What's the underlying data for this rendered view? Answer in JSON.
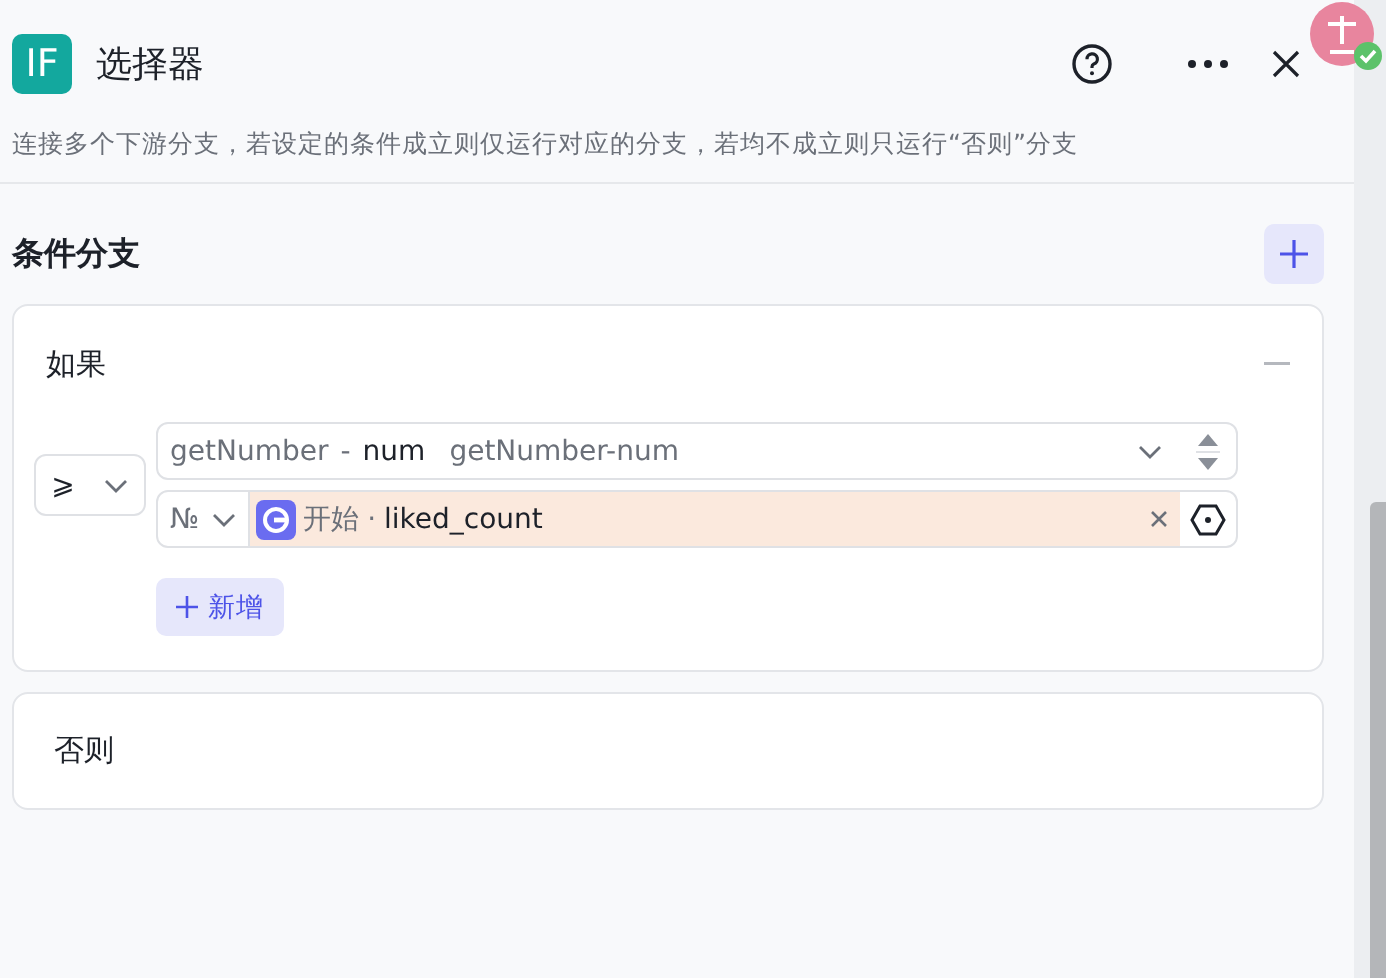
{
  "header": {
    "logo": "IF",
    "title": "选择器"
  },
  "description": "连接多个下游分支，若设定的条件成立则仅运行对应的分支，若均不成立则只运行“否则”分支",
  "section": {
    "title": "条件分支"
  },
  "branches": [
    {
      "kind": "if",
      "title": "如果",
      "operator": "⩾",
      "left": {
        "source": "getNumber",
        "separator": "-",
        "field": "num",
        "label": "getNumber-num"
      },
      "right": {
        "type_symbol": "№",
        "node": "开始",
        "separator": "·",
        "variable": "liked_count"
      },
      "add_label": "新增"
    },
    {
      "kind": "else",
      "title": "否则"
    }
  ]
}
